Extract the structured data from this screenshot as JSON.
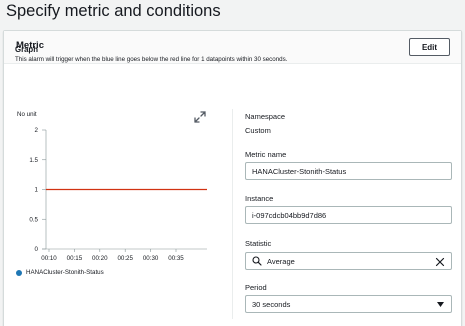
{
  "page": {
    "title": "Specify metric and conditions"
  },
  "metric_panel": {
    "title": "Metric",
    "edit_label": "Edit"
  },
  "graph": {
    "title": "Graph",
    "description": "This alarm will trigger when the blue line goes below the red line for 1 datapoints within 30 seconds.",
    "unit_label": "No unit",
    "legend_label": "HANACluster-Stonith-Status"
  },
  "chart_data": {
    "type": "line",
    "x": [
      "00:10",
      "00:15",
      "00:20",
      "00:25",
      "00:30",
      "00:35"
    ],
    "ylim": [
      0,
      2
    ],
    "yticks": [
      "2",
      "1.5",
      "1",
      "0.5",
      "0"
    ],
    "ylabel": "No unit",
    "threshold": {
      "value": 1,
      "color": "#d13212"
    },
    "series": [
      {
        "name": "HANACluster-Stonith-Status",
        "values": [],
        "color": "#1f77b4"
      }
    ]
  },
  "fields": {
    "namespace_label": "Namespace",
    "namespace_value": "Custom",
    "metric_name_label": "Metric name",
    "metric_name_value": "HANACluster-Stonith-Status",
    "instance_label": "Instance",
    "instance_value": "i-097cdcb04bb9d7d86",
    "statistic_label": "Statistic",
    "statistic_value": "Average",
    "period_label": "Period",
    "period_value": "30 seconds"
  },
  "colors": {
    "threshold": "#d13212",
    "series": "#1f77b4",
    "grid": "#eaeded"
  }
}
